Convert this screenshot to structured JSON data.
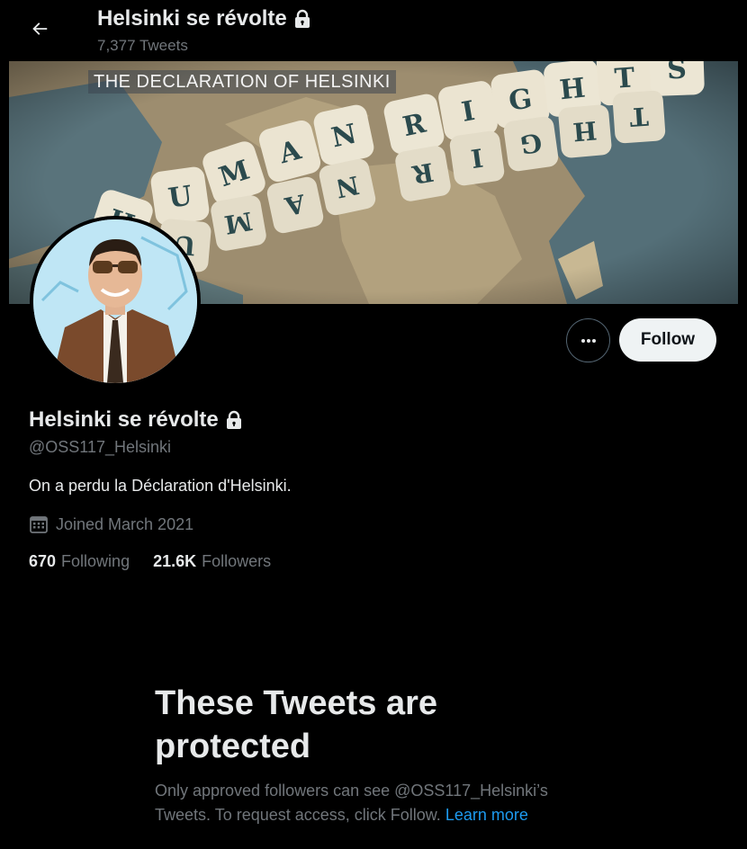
{
  "header": {
    "name": "Helsinki se révolte",
    "tweet_count": "7,377 Tweets"
  },
  "banner": {
    "label": "THE DECLARATION OF HELSINKI",
    "dice_line1": "HUMAN RIGHTS",
    "dice_line2": "HUMAN RIGHTS"
  },
  "actions": {
    "more_icon": "more-horizontal-icon",
    "follow_label": "Follow"
  },
  "profile": {
    "name": "Helsinki se révolte",
    "handle": "@OSS117_Helsinki",
    "bio": "On a perdu la Déclaration d'Helsinki.",
    "joined": "Joined March 2021",
    "following_count": "670",
    "following_label": "Following",
    "followers_count": "21.6K",
    "followers_label": "Followers"
  },
  "protected": {
    "title": "These Tweets are protected",
    "description": "Only approved followers can see @OSS117_Helsinki’s Tweets. To request access, click Follow.",
    "link": "Learn more"
  },
  "colors": {
    "background": "#000000",
    "text_primary": "#e7e9ea",
    "text_secondary": "#71767b",
    "link": "#1d9bf0",
    "follow_bg": "#eff3f4"
  }
}
